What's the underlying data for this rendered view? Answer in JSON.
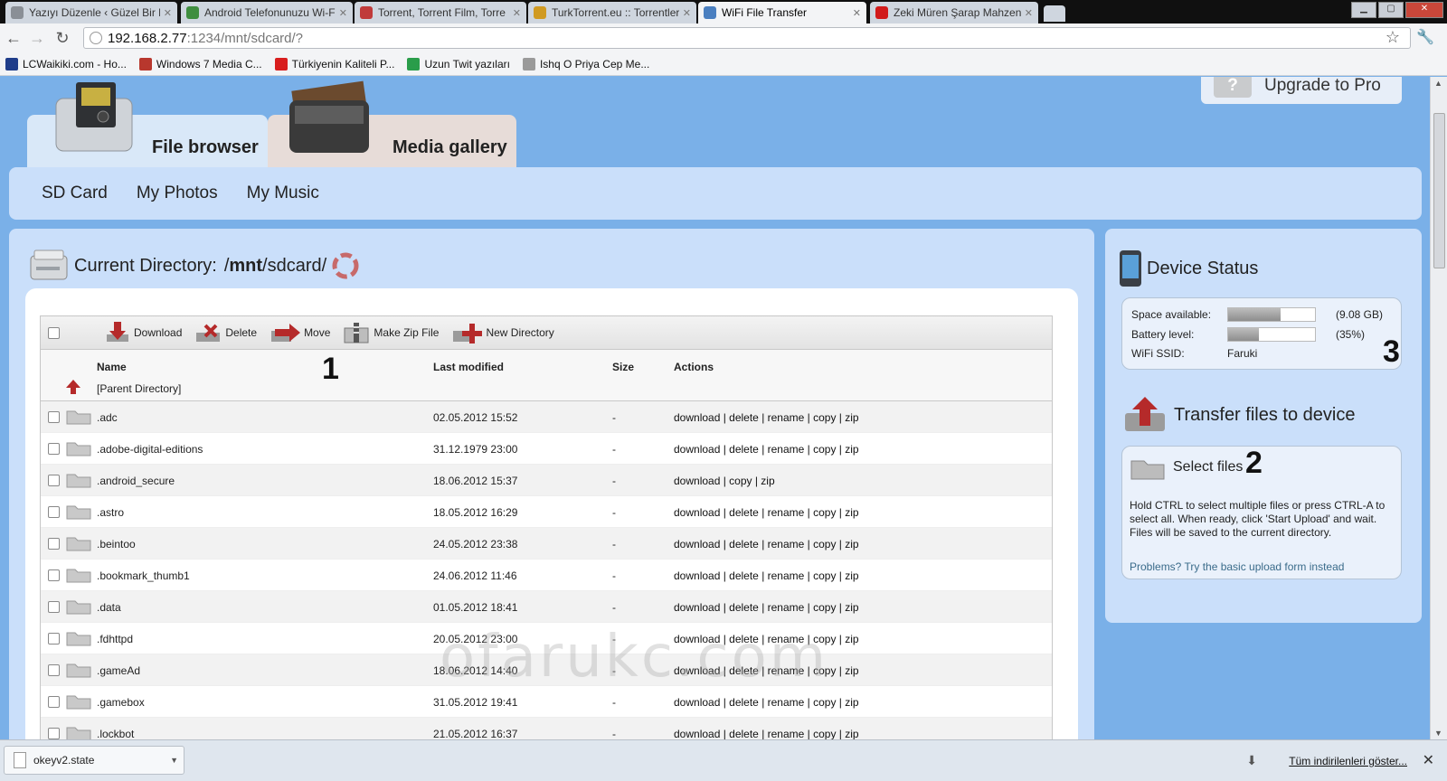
{
  "browser": {
    "tabs": [
      {
        "title": "Yazıyı Düzenle ‹ Güzel Bir B",
        "color": "#8a8f96"
      },
      {
        "title": "Android Telefonunuzu Wi-F",
        "color": "#3f8e3f"
      },
      {
        "title": "Torrent, Torrent Film, Torre",
        "color": "#c03a3a"
      },
      {
        "title": "TurkTorrent.eu :: Torrentleri",
        "color": "#d09a22"
      },
      {
        "title": "WiFi File Transfer",
        "color": "#4a7fc0"
      },
      {
        "title": "Zeki Müren Şarap Mahzend",
        "color": "#d11a1a"
      }
    ],
    "url_host": "192.168.2.77",
    "url_rest": ":1234/mnt/sdcard/?",
    "bookmarks": [
      {
        "label": "LCWaikiki.com - Ho...",
        "color": "#1f3d8a"
      },
      {
        "label": "Windows 7 Media C...",
        "color": "#b8372d"
      },
      {
        "label": "Türkiyenin Kaliteli P...",
        "color": "#d81e1e"
      },
      {
        "label": "Uzun Twit yazıları",
        "color": "#2a9d4a"
      },
      {
        "label": "Ishq O Priya Cep Me...",
        "color": "#9a9a9a"
      }
    ]
  },
  "header": {
    "upgrade_label": "Upgrade to Pro",
    "tabs": {
      "file_browser": "File browser",
      "media_gallery": "Media gallery"
    },
    "subnav": [
      "SD Card",
      "My Photos",
      "My Music"
    ]
  },
  "browser_panel": {
    "current_dir_label": "Current Directory:",
    "path_prefix": "/",
    "path_bold": "mnt",
    "path_suffix": "/sdcard/",
    "actions": [
      "Download",
      "Delete",
      "Move",
      "Make Zip File",
      "New Directory"
    ],
    "columns": {
      "name": "Name",
      "modified": "Last modified",
      "size": "Size",
      "actions": "Actions"
    },
    "parent_dir": "[Parent Directory]",
    "rows": [
      {
        "name": ".adc",
        "modified": "02.05.2012 15:52",
        "size": "-",
        "actions": "download | delete | rename | copy | zip"
      },
      {
        "name": ".adobe-digital-editions",
        "modified": "31.12.1979 23:00",
        "size": "-",
        "actions": "download | delete | rename | copy | zip"
      },
      {
        "name": ".android_secure",
        "modified": "18.06.2012 15:37",
        "size": "-",
        "actions": "download | copy | zip"
      },
      {
        "name": ".astro",
        "modified": "18.05.2012 16:29",
        "size": "-",
        "actions": "download | delete | rename | copy | zip"
      },
      {
        "name": ".beintoo",
        "modified": "24.05.2012 23:38",
        "size": "-",
        "actions": "download | delete | rename | copy | zip"
      },
      {
        "name": ".bookmark_thumb1",
        "modified": "24.06.2012 11:46",
        "size": "-",
        "actions": "download | delete | rename | copy | zip"
      },
      {
        "name": ".data",
        "modified": "01.05.2012 18:41",
        "size": "-",
        "actions": "download | delete | rename | copy | zip"
      },
      {
        "name": ".fdhttpd",
        "modified": "20.05.2012 23:00",
        "size": "-",
        "actions": "download | delete | rename | copy | zip"
      },
      {
        "name": ".gameAd",
        "modified": "18.06.2012 14:40",
        "size": "-",
        "actions": "download | delete | rename | copy | zip"
      },
      {
        "name": ".gamebox",
        "modified": "31.05.2012 19:41",
        "size": "-",
        "actions": "download | delete | rename | copy | zip"
      },
      {
        "name": ".lockbot",
        "modified": "21.05.2012 16:37",
        "size": "-",
        "actions": "download | delete | rename | copy | zip"
      }
    ]
  },
  "device_status": {
    "title": "Device Status",
    "space_label": "Space available:",
    "space_value": "(9.08 GB)",
    "space_fraction": 0.6,
    "battery_label": "Battery level:",
    "battery_value": "(35%)",
    "battery_fraction": 0.35,
    "ssid_label": "WiFi SSID:",
    "ssid_value": "Faruki"
  },
  "transfer": {
    "title": "Transfer files to device",
    "select_label": "Select files",
    "help": "Hold CTRL to select multiple files or press CTRL-A to select all. When ready, click 'Start Upload' and wait. Files will be saved to the current directory.",
    "problems": "Problems? Try the basic upload form instead"
  },
  "annotations": {
    "one": "1",
    "two": "2",
    "three": "3"
  },
  "watermark": "ofarukc.com",
  "downloads": {
    "file": "okeyv2.state",
    "show_all": "Tüm indirilenleri göster..."
  }
}
